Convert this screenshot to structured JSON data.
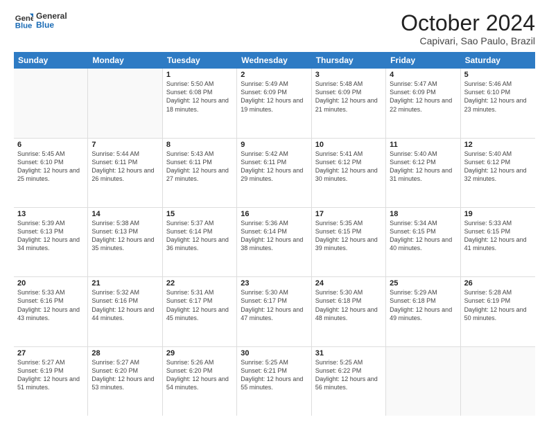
{
  "logo": {
    "line1": "General",
    "line2": "Blue"
  },
  "title": "October 2024",
  "location": "Capivari, Sao Paulo, Brazil",
  "header_days": [
    "Sunday",
    "Monday",
    "Tuesday",
    "Wednesday",
    "Thursday",
    "Friday",
    "Saturday"
  ],
  "weeks": [
    [
      {
        "day": "",
        "sunrise": "",
        "sunset": "",
        "daylight": ""
      },
      {
        "day": "",
        "sunrise": "",
        "sunset": "",
        "daylight": ""
      },
      {
        "day": "1",
        "sunrise": "Sunrise: 5:50 AM",
        "sunset": "Sunset: 6:08 PM",
        "daylight": "Daylight: 12 hours and 18 minutes."
      },
      {
        "day": "2",
        "sunrise": "Sunrise: 5:49 AM",
        "sunset": "Sunset: 6:09 PM",
        "daylight": "Daylight: 12 hours and 19 minutes."
      },
      {
        "day": "3",
        "sunrise": "Sunrise: 5:48 AM",
        "sunset": "Sunset: 6:09 PM",
        "daylight": "Daylight: 12 hours and 21 minutes."
      },
      {
        "day": "4",
        "sunrise": "Sunrise: 5:47 AM",
        "sunset": "Sunset: 6:09 PM",
        "daylight": "Daylight: 12 hours and 22 minutes."
      },
      {
        "day": "5",
        "sunrise": "Sunrise: 5:46 AM",
        "sunset": "Sunset: 6:10 PM",
        "daylight": "Daylight: 12 hours and 23 minutes."
      }
    ],
    [
      {
        "day": "6",
        "sunrise": "Sunrise: 5:45 AM",
        "sunset": "Sunset: 6:10 PM",
        "daylight": "Daylight: 12 hours and 25 minutes."
      },
      {
        "day": "7",
        "sunrise": "Sunrise: 5:44 AM",
        "sunset": "Sunset: 6:11 PM",
        "daylight": "Daylight: 12 hours and 26 minutes."
      },
      {
        "day": "8",
        "sunrise": "Sunrise: 5:43 AM",
        "sunset": "Sunset: 6:11 PM",
        "daylight": "Daylight: 12 hours and 27 minutes."
      },
      {
        "day": "9",
        "sunrise": "Sunrise: 5:42 AM",
        "sunset": "Sunset: 6:11 PM",
        "daylight": "Daylight: 12 hours and 29 minutes."
      },
      {
        "day": "10",
        "sunrise": "Sunrise: 5:41 AM",
        "sunset": "Sunset: 6:12 PM",
        "daylight": "Daylight: 12 hours and 30 minutes."
      },
      {
        "day": "11",
        "sunrise": "Sunrise: 5:40 AM",
        "sunset": "Sunset: 6:12 PM",
        "daylight": "Daylight: 12 hours and 31 minutes."
      },
      {
        "day": "12",
        "sunrise": "Sunrise: 5:40 AM",
        "sunset": "Sunset: 6:12 PM",
        "daylight": "Daylight: 12 hours and 32 minutes."
      }
    ],
    [
      {
        "day": "13",
        "sunrise": "Sunrise: 5:39 AM",
        "sunset": "Sunset: 6:13 PM",
        "daylight": "Daylight: 12 hours and 34 minutes."
      },
      {
        "day": "14",
        "sunrise": "Sunrise: 5:38 AM",
        "sunset": "Sunset: 6:13 PM",
        "daylight": "Daylight: 12 hours and 35 minutes."
      },
      {
        "day": "15",
        "sunrise": "Sunrise: 5:37 AM",
        "sunset": "Sunset: 6:14 PM",
        "daylight": "Daylight: 12 hours and 36 minutes."
      },
      {
        "day": "16",
        "sunrise": "Sunrise: 5:36 AM",
        "sunset": "Sunset: 6:14 PM",
        "daylight": "Daylight: 12 hours and 38 minutes."
      },
      {
        "day": "17",
        "sunrise": "Sunrise: 5:35 AM",
        "sunset": "Sunset: 6:15 PM",
        "daylight": "Daylight: 12 hours and 39 minutes."
      },
      {
        "day": "18",
        "sunrise": "Sunrise: 5:34 AM",
        "sunset": "Sunset: 6:15 PM",
        "daylight": "Daylight: 12 hours and 40 minutes."
      },
      {
        "day": "19",
        "sunrise": "Sunrise: 5:33 AM",
        "sunset": "Sunset: 6:15 PM",
        "daylight": "Daylight: 12 hours and 41 minutes."
      }
    ],
    [
      {
        "day": "20",
        "sunrise": "Sunrise: 5:33 AM",
        "sunset": "Sunset: 6:16 PM",
        "daylight": "Daylight: 12 hours and 43 minutes."
      },
      {
        "day": "21",
        "sunrise": "Sunrise: 5:32 AM",
        "sunset": "Sunset: 6:16 PM",
        "daylight": "Daylight: 12 hours and 44 minutes."
      },
      {
        "day": "22",
        "sunrise": "Sunrise: 5:31 AM",
        "sunset": "Sunset: 6:17 PM",
        "daylight": "Daylight: 12 hours and 45 minutes."
      },
      {
        "day": "23",
        "sunrise": "Sunrise: 5:30 AM",
        "sunset": "Sunset: 6:17 PM",
        "daylight": "Daylight: 12 hours and 47 minutes."
      },
      {
        "day": "24",
        "sunrise": "Sunrise: 5:30 AM",
        "sunset": "Sunset: 6:18 PM",
        "daylight": "Daylight: 12 hours and 48 minutes."
      },
      {
        "day": "25",
        "sunrise": "Sunrise: 5:29 AM",
        "sunset": "Sunset: 6:18 PM",
        "daylight": "Daylight: 12 hours and 49 minutes."
      },
      {
        "day": "26",
        "sunrise": "Sunrise: 5:28 AM",
        "sunset": "Sunset: 6:19 PM",
        "daylight": "Daylight: 12 hours and 50 minutes."
      }
    ],
    [
      {
        "day": "27",
        "sunrise": "Sunrise: 5:27 AM",
        "sunset": "Sunset: 6:19 PM",
        "daylight": "Daylight: 12 hours and 51 minutes."
      },
      {
        "day": "28",
        "sunrise": "Sunrise: 5:27 AM",
        "sunset": "Sunset: 6:20 PM",
        "daylight": "Daylight: 12 hours and 53 minutes."
      },
      {
        "day": "29",
        "sunrise": "Sunrise: 5:26 AM",
        "sunset": "Sunset: 6:20 PM",
        "daylight": "Daylight: 12 hours and 54 minutes."
      },
      {
        "day": "30",
        "sunrise": "Sunrise: 5:25 AM",
        "sunset": "Sunset: 6:21 PM",
        "daylight": "Daylight: 12 hours and 55 minutes."
      },
      {
        "day": "31",
        "sunrise": "Sunrise: 5:25 AM",
        "sunset": "Sunset: 6:22 PM",
        "daylight": "Daylight: 12 hours and 56 minutes."
      },
      {
        "day": "",
        "sunrise": "",
        "sunset": "",
        "daylight": ""
      },
      {
        "day": "",
        "sunrise": "",
        "sunset": "",
        "daylight": ""
      }
    ]
  ]
}
